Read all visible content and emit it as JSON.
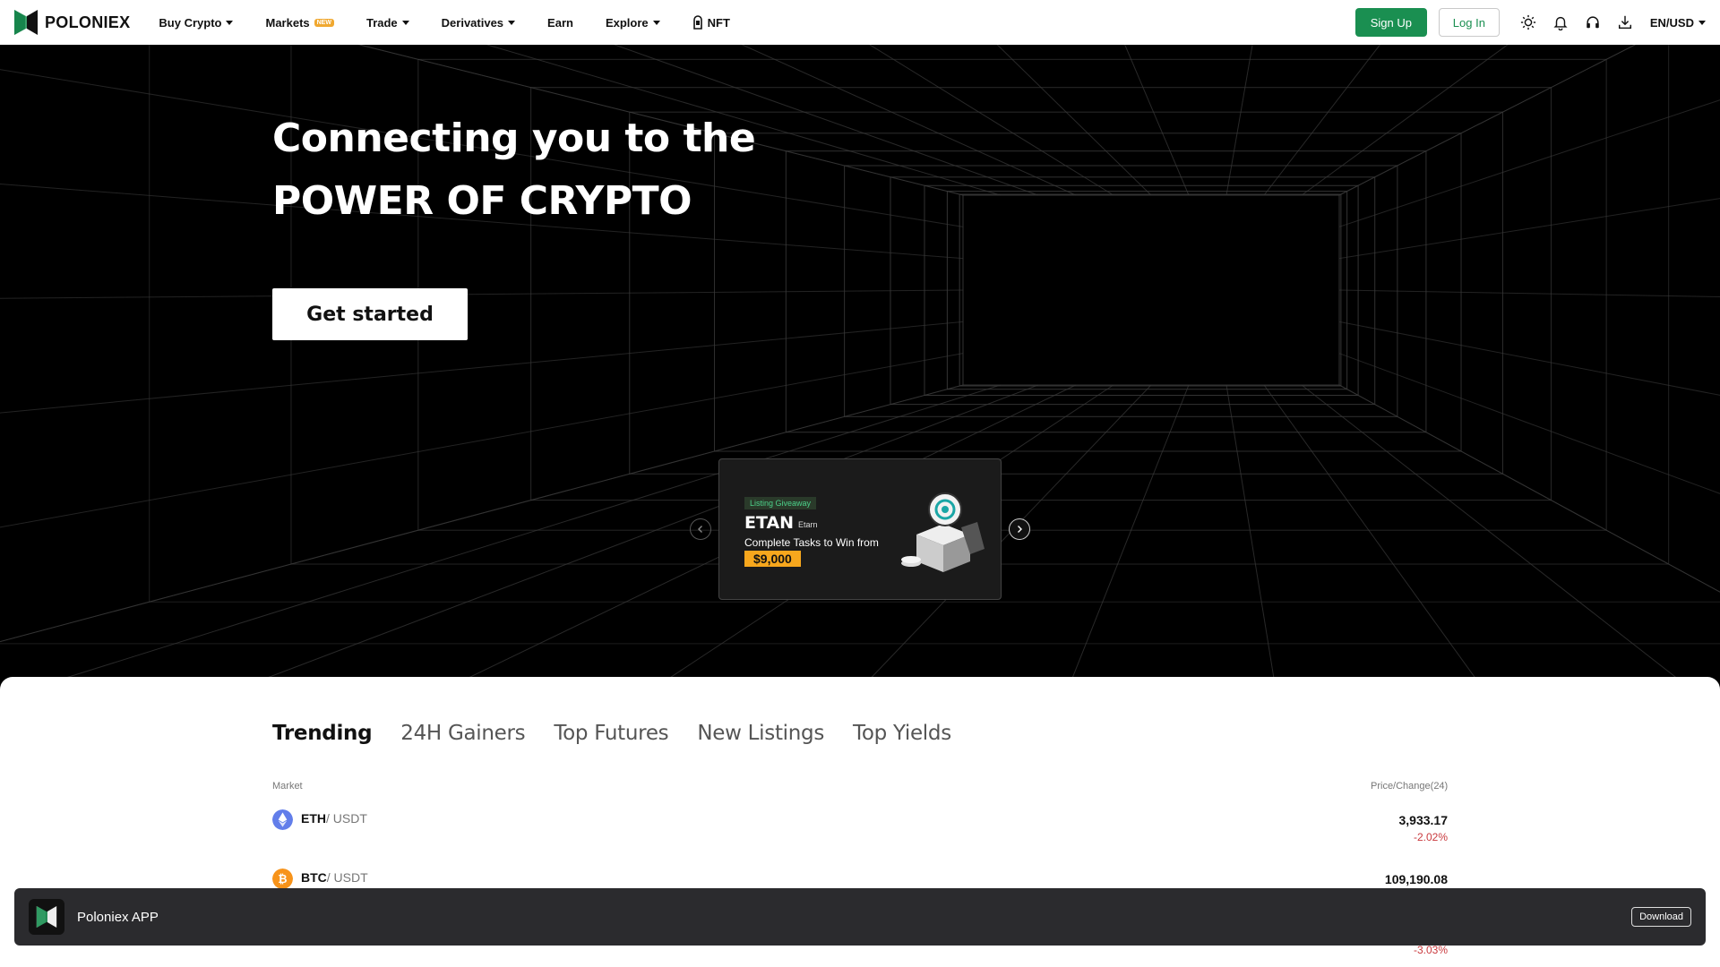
{
  "header": {
    "brand": "POLONIEX",
    "nav": [
      {
        "label": "Buy Crypto",
        "caret": true
      },
      {
        "label": "Markets",
        "badge": "NEW"
      },
      {
        "label": "Trade",
        "caret": true
      },
      {
        "label": "Derivatives",
        "caret": true
      },
      {
        "label": "Earn"
      },
      {
        "label": "Explore",
        "caret": true
      },
      {
        "label": "NFT",
        "icon": "nft-icon"
      }
    ],
    "signup_label": "Sign Up",
    "login_label": "Log In",
    "icons": [
      "theme-icon",
      "bell-icon",
      "headset-icon",
      "download-icon"
    ],
    "lang": "EN/USD"
  },
  "hero": {
    "title_line1": "Connecting you to the",
    "title_line2": "POWER OF CRYPTO",
    "cta": "Get started",
    "banner": {
      "tag": "Listing Giveaway",
      "token": "ETAN",
      "token_sub": "Etarn",
      "desc": "Complete Tasks to Win from",
      "prize": "$9,000"
    }
  },
  "markets": {
    "tabs": [
      "Trending",
      "24H Gainers",
      "Top Futures",
      "New Listings",
      "Top Yields"
    ],
    "active_tab": 0,
    "col_market": "Market",
    "col_price": "Price/Change(24)",
    "rows": [
      {
        "base": "ETH",
        "quote": "/ USDT",
        "price": "3,933.17",
        "change": "-2.02%",
        "color": "#627eea"
      },
      {
        "base": "BTC",
        "quote": "/ USDT",
        "price": "109,190.08",
        "change": "",
        "color": "#f7931a"
      }
    ],
    "partial_change": "-3.03%"
  },
  "appbar": {
    "name": "Poloniex APP",
    "download": "Download"
  },
  "colors": {
    "brand_green": "#1a8f51",
    "negative": "#c9393d",
    "accent": "#f7a71d"
  }
}
